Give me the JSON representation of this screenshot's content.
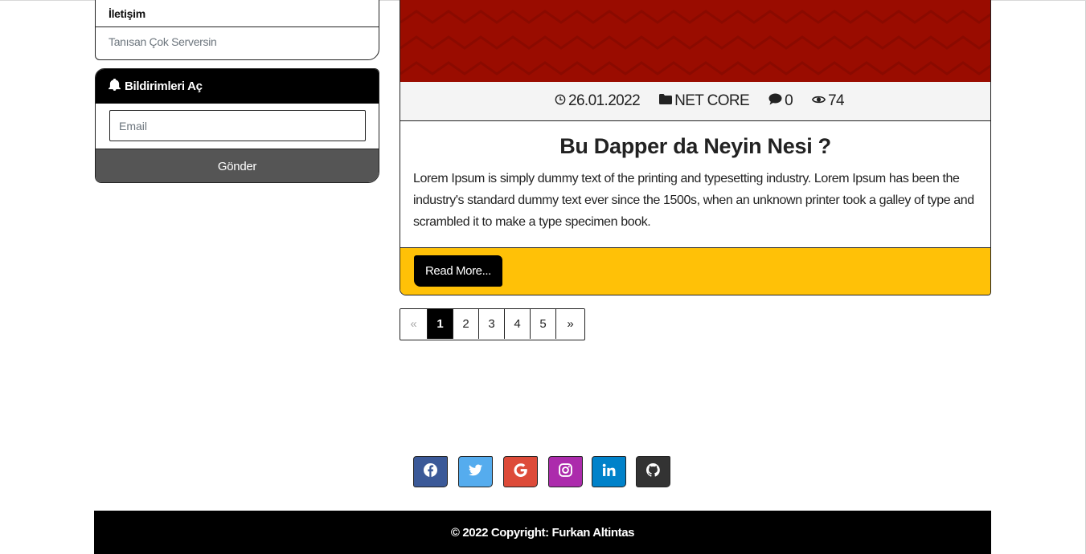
{
  "sidebar": {
    "menu_items": [
      {
        "label": "İletişim"
      },
      {
        "label": "Tanısan Çok Serversin"
      }
    ]
  },
  "notify": {
    "title": "Bildirimleri Aç",
    "email_placeholder": "Email",
    "submit_label": "Gönder"
  },
  "post": {
    "date": "26.01.2022",
    "category": "NET CORE",
    "comments": "0",
    "views": "74",
    "title": "Bu Dapper da Neyin Nesi ?",
    "excerpt": "Lorem Ipsum is simply dummy text of the printing and typesetting industry. Lorem Ipsum has been the industry's standard dummy text ever since the 1500s, when an unknown printer took a galley of type and scrambled it to make a type specimen book.",
    "read_more_label": "Read More...",
    "image_color": "#9a0c00",
    "footer_color": "#ffc107"
  },
  "pagination": {
    "prev": "«",
    "pages": [
      "1",
      "2",
      "3",
      "4",
      "5"
    ],
    "active": "1",
    "next": "»"
  },
  "social": [
    {
      "name": "facebook-icon",
      "color": "#3b5998"
    },
    {
      "name": "twitter-icon",
      "color": "#55acee"
    },
    {
      "name": "google-icon",
      "color": "#dd4b39"
    },
    {
      "name": "instagram-icon",
      "color": "#ac2bac"
    },
    {
      "name": "linkedin-icon",
      "color": "#0082ca"
    },
    {
      "name": "github-icon",
      "color": "#333333"
    }
  ],
  "footer": {
    "copyright": "© 2022 Copyright: Furkan Altintas"
  }
}
